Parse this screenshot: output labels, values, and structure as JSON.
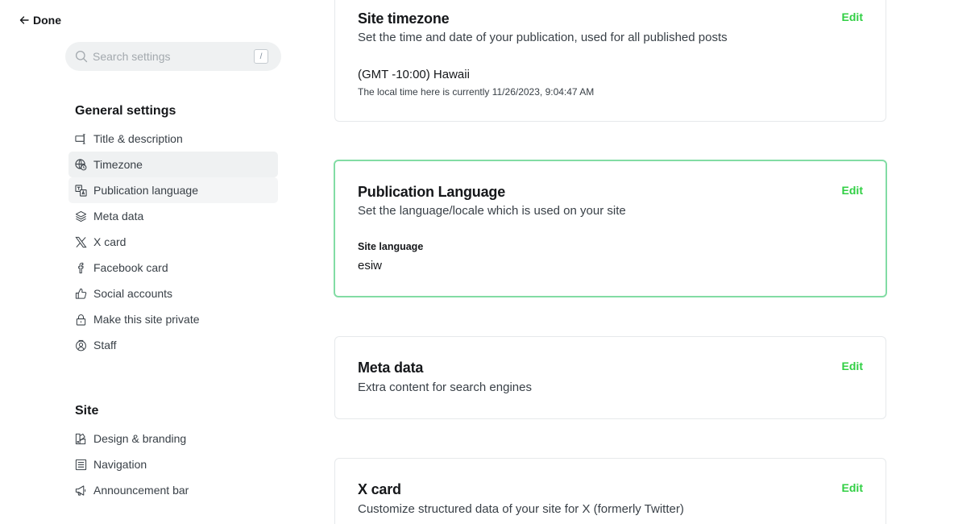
{
  "sidebar": {
    "done_label": "Done",
    "search": {
      "placeholder": "Search settings",
      "shortcut": "/"
    },
    "general": {
      "heading": "General settings",
      "items": [
        {
          "label": "Title & description",
          "icon": "title-description-icon"
        },
        {
          "label": "Timezone",
          "icon": "globe-clock-icon"
        },
        {
          "label": "Publication language",
          "icon": "language-icon"
        },
        {
          "label": "Meta data",
          "icon": "layers-icon"
        },
        {
          "label": "X card",
          "icon": "x-logo-icon"
        },
        {
          "label": "Facebook card",
          "icon": "facebook-icon"
        },
        {
          "label": "Social accounts",
          "icon": "thumbs-up-icon"
        },
        {
          "label": "Make this site private",
          "icon": "lock-icon"
        },
        {
          "label": "Staff",
          "icon": "staff-icon"
        }
      ]
    },
    "site": {
      "heading": "Site",
      "items": [
        {
          "label": "Design & branding",
          "icon": "paintbrush-icon"
        },
        {
          "label": "Navigation",
          "icon": "navigation-icon"
        },
        {
          "label": "Announcement bar",
          "icon": "megaphone-icon"
        }
      ]
    }
  },
  "cards": {
    "timezone": {
      "title": "Site timezone",
      "description": "Set the time and date of your publication, used for all published posts",
      "edit": "Edit",
      "value": "(GMT -10:00) Hawaii",
      "hint": "The local time here is currently 11/26/2023, 9:04:47 AM"
    },
    "language": {
      "title": "Publication Language",
      "description": "Set the language/locale which is used on your site",
      "edit": "Edit",
      "field_label": "Site language",
      "value": "esiw"
    },
    "meta": {
      "title": "Meta data",
      "description": "Extra content for search engines",
      "edit": "Edit"
    },
    "xcard": {
      "title": "X card",
      "description": "Customize structured data of your site for X (formerly Twitter)",
      "edit": "Edit"
    }
  },
  "colors": {
    "accent_green": "#30cf43",
    "highlight_border": "#82dca4",
    "active_nav_bg": "#eff1f2"
  }
}
